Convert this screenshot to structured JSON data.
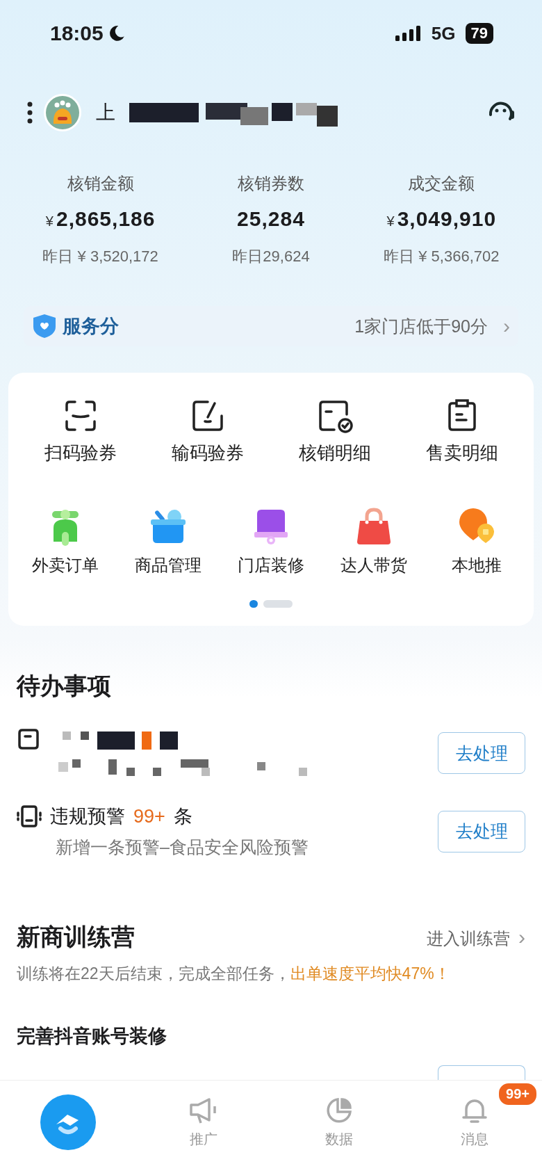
{
  "status_bar": {
    "time": "18:05",
    "network": "5G",
    "battery": "79"
  },
  "header": {
    "store_name": "上"
  },
  "stats": [
    {
      "label": "核销金额",
      "currency": "¥",
      "value": "2,865,186",
      "yesterday": "昨日 ¥ 3,520,172"
    },
    {
      "label": "核销券数",
      "value": "25,284",
      "yesterday": "昨日29,624"
    },
    {
      "label": "成交金额",
      "currency": "¥",
      "value": "3,049,910",
      "yesterday": "昨日 ¥ 5,366,702"
    }
  ],
  "service_score": {
    "label": "服务分",
    "note": "1家门店低于90分",
    "chevron": "›"
  },
  "tools_row_1": [
    {
      "label": "扫码验券"
    },
    {
      "label": "输码验券"
    },
    {
      "label": "核销明细"
    },
    {
      "label": "售卖明细"
    }
  ],
  "tools_row_2": [
    {
      "label": "外卖订单"
    },
    {
      "label": "商品管理"
    },
    {
      "label": "门店装修"
    },
    {
      "label": "达人带货"
    },
    {
      "label": "本地推"
    }
  ],
  "pager": [
    {
      "selected": true
    },
    {
      "selected": false
    }
  ],
  "todo": {
    "title": "待办事项",
    "items": [
      {
        "kind": "redacted",
        "button": "去处理"
      },
      {
        "kind": "warning",
        "title": "违规预警",
        "count": "99+",
        "unit": "条",
        "subtitle": "新增一条预警–食品安全风险预警",
        "button": "去处理"
      }
    ]
  },
  "training": {
    "title": "新商训练营",
    "link": "进入训练营",
    "chevron": "›",
    "subtitle": "训练将在22天后结束，完成全部任务，",
    "highlight": "出单速度平均快47%！",
    "task": "完善抖音账号装修"
  },
  "tab_bar": [
    {
      "selected": true
    },
    {
      "label": "推广",
      "selected": false
    },
    {
      "label": "数据",
      "selected": false
    },
    {
      "label": "消息",
      "selected": false,
      "badge": "99+"
    }
  ]
}
